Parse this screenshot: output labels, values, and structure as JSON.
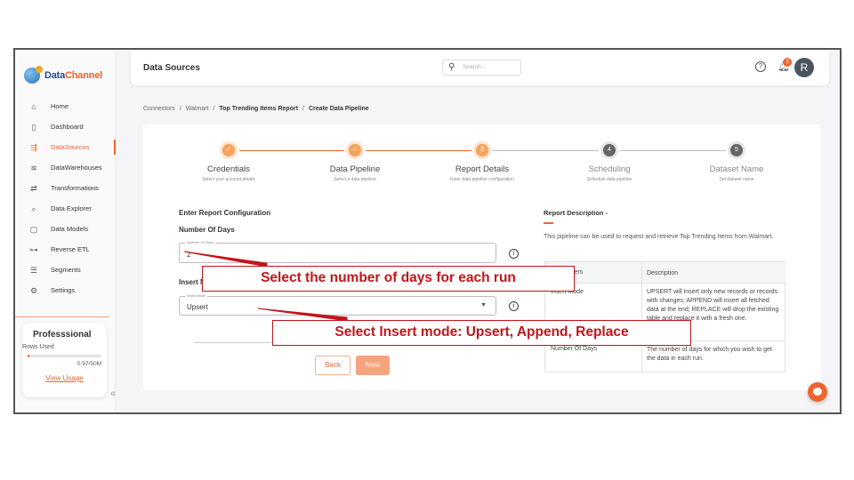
{
  "brand": {
    "name_part1": "Data",
    "name_part2": "Channel",
    "accent": "#f0642f"
  },
  "sidebar": {
    "items": [
      {
        "label": "Home",
        "icon": "home-icon",
        "glyph": "⌂"
      },
      {
        "label": "Dashboard",
        "icon": "dashboard-icon",
        "glyph": "▯"
      },
      {
        "label": "DataSources",
        "icon": "datasources-icon",
        "glyph": "⇶",
        "active": true
      },
      {
        "label": "DataWarehouses",
        "icon": "datawarehouse-icon",
        "glyph": "≋"
      },
      {
        "label": "Transformations",
        "icon": "transformations-icon",
        "glyph": "⇄"
      },
      {
        "label": "Data Explorer",
        "icon": "data-explorer-icon",
        "glyph": "⌕"
      },
      {
        "label": "Data Models",
        "icon": "data-models-icon",
        "glyph": "▢"
      },
      {
        "label": "Reverse ETL",
        "icon": "reverse-etl-icon",
        "glyph": "⊶"
      },
      {
        "label": "Segments",
        "icon": "segments-icon",
        "glyph": "☰"
      },
      {
        "label": "Settings",
        "icon": "settings-icon",
        "glyph": "⚙"
      }
    ],
    "plan": {
      "name": "Professsional",
      "rows_label": "Rows Used",
      "rows_value": "0.97/50M",
      "link": "View Usage",
      "usage_fraction": 0.02
    },
    "collapse_glyph": "«"
  },
  "header": {
    "title": "Data Sources",
    "search_placeholder": "Search...",
    "help_glyph": "?",
    "notifications_count": "2",
    "avatar_initial": "R"
  },
  "breadcrumb": {
    "items": [
      "Connectors",
      "Walmart",
      "Top Trending Items Report",
      "Create Data Pipeline"
    ],
    "separator": "/"
  },
  "stepper": {
    "steps": [
      {
        "label": "Credentials",
        "sub": "Select your account details",
        "state": "done",
        "marker": "✓"
      },
      {
        "label": "Data Pipeline",
        "sub": "Select a data pipeline",
        "state": "done",
        "marker": "✓"
      },
      {
        "label": "Report Details",
        "sub": "Enter data pipeline configuration",
        "state": "current",
        "marker": "3"
      },
      {
        "label": "Scheduling",
        "sub": "Schedule data pipeline",
        "state": "todo",
        "marker": "4"
      },
      {
        "label": "Dataset Name",
        "sub": "Set dataset name",
        "state": "todo",
        "marker": "5"
      }
    ]
  },
  "form": {
    "section_title": "Enter Report Configuration",
    "days_label": "Number Of Days",
    "days_field_label": "Number Of Days",
    "days_value": "2",
    "insert_label": "Insert Mode",
    "insert_field_label": "Insert Mode",
    "insert_value": "Upsert",
    "back_label": "Back",
    "next_label": "Next"
  },
  "description": {
    "title": "Report Description -",
    "text": "This pipeline can be used to request and retrieve Top Trending Items from Walmart.",
    "table": {
      "headers": [
        "Parameters",
        "Description"
      ],
      "rows": [
        [
          "Insert Mode",
          "UPSERT will insert only new records or records with changes; APPEND will insert all fetched data at the end; REPLACE will drop the existing table and replace it with a fresh one."
        ],
        [
          "Number Of Days",
          "The number of days for which you wish to get the data in each run."
        ]
      ]
    }
  },
  "callouts": {
    "days": "Select the number of days for each run",
    "insert": "Select Insert mode: Upsert, Append, Replace"
  }
}
